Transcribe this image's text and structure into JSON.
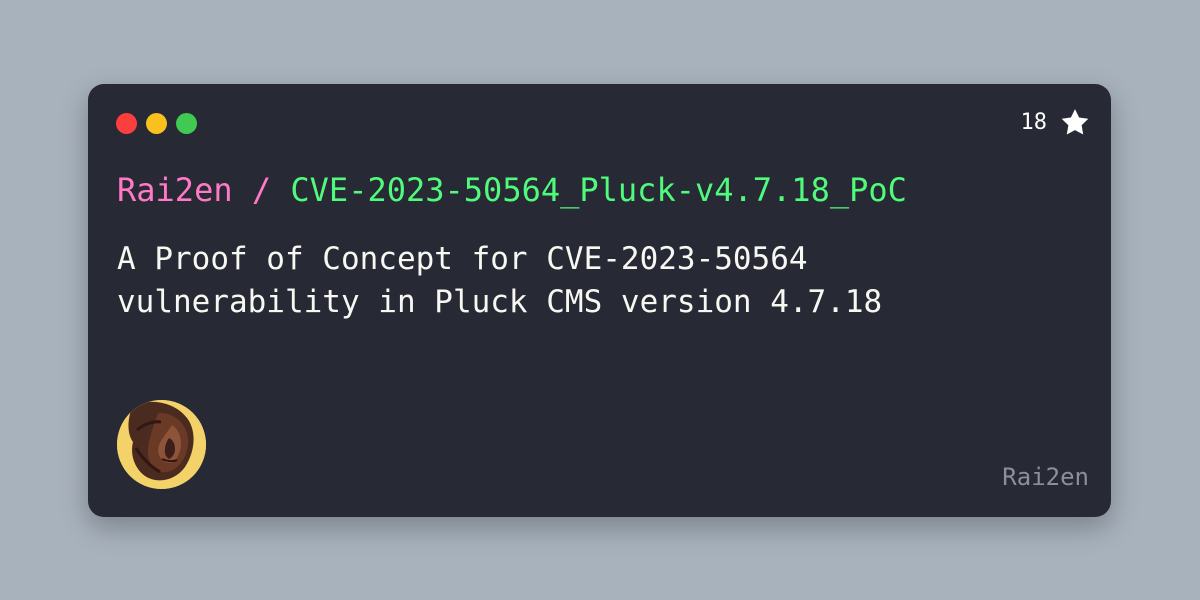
{
  "card": {
    "owner": "Rai2en",
    "separator": " / ",
    "repo": "CVE-2023-50564_Pluck-v4.7.18_PoC",
    "description": "A Proof of Concept for CVE-2023-50564\nvulnerability in Pluck CMS version 4.7.18",
    "stars": "18",
    "footer_username": "Rai2en"
  },
  "icons": {
    "window_controls": [
      "close",
      "minimize",
      "maximize"
    ],
    "star": "star-icon",
    "avatar": "user-avatar"
  },
  "colors": {
    "page_background": "#a8b2bd",
    "card_background": "#272935",
    "owner_text": "#ff79c6",
    "repo_text": "#50fa7b",
    "description_text": "#f8f8f2",
    "muted_text": "#8c8f99",
    "red_dot": "#fb3f3f",
    "yellow_dot": "#f9c01e",
    "green_dot": "#40ca52"
  }
}
